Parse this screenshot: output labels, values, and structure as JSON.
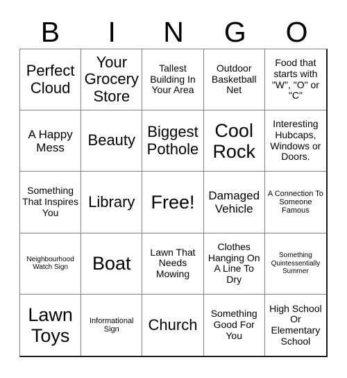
{
  "header": {
    "letters": [
      "B",
      "I",
      "N",
      "G",
      "O"
    ]
  },
  "grid": {
    "rows": 5,
    "columns": 5,
    "free_space_index": 12,
    "cells": [
      {
        "text": "Perfect Cloud",
        "size": "fs-lg"
      },
      {
        "text": "Your Grocery Store",
        "size": "fs-lg"
      },
      {
        "text": "Tallest Building In Your Area",
        "size": "fs-sm"
      },
      {
        "text": "Outdoor Basketball Net",
        "size": "fs-sm"
      },
      {
        "text": "Food that starts with \"W\", \"O\" or \"C\"",
        "size": "fs-sm"
      },
      {
        "text": "A Happy Mess",
        "size": "fs-md"
      },
      {
        "text": "Beauty",
        "size": "fs-lg"
      },
      {
        "text": "Biggest Pothole",
        "size": "fs-lg"
      },
      {
        "text": "Cool Rock",
        "size": "fs-xl"
      },
      {
        "text": "Interesting Hubcaps, Windows or Doors.",
        "size": "fs-sm"
      },
      {
        "text": "Something That Inspires You",
        "size": "fs-sm"
      },
      {
        "text": "Library",
        "size": "fs-lg"
      },
      {
        "text": "Free!",
        "size": "fs-xl"
      },
      {
        "text": "Damaged Vehicle",
        "size": "fs-md"
      },
      {
        "text": "A Connection To Someone Famous",
        "size": "fs-xs"
      },
      {
        "text": "Neighbourhood Watch Sign",
        "size": "fs-xxs"
      },
      {
        "text": "Boat",
        "size": "fs-xl"
      },
      {
        "text": "Lawn That Needs Mowing",
        "size": "fs-sm"
      },
      {
        "text": "Clothes Hanging On A Line To Dry",
        "size": "fs-sm"
      },
      {
        "text": "Something Quintessentially Summer",
        "size": "fs-xxs"
      },
      {
        "text": "Lawn Toys",
        "size": "fs-xl"
      },
      {
        "text": "Informational Sign",
        "size": "fs-xs"
      },
      {
        "text": "Church",
        "size": "fs-lg"
      },
      {
        "text": "Something Good For You",
        "size": "fs-sm"
      },
      {
        "text": "High School Or Elementary School",
        "size": "fs-sm"
      }
    ]
  },
  "colors": {
    "background": "#ffffff",
    "text": "#000000",
    "grid_line": "#808080",
    "grid_outer": "#1a1a1a"
  }
}
